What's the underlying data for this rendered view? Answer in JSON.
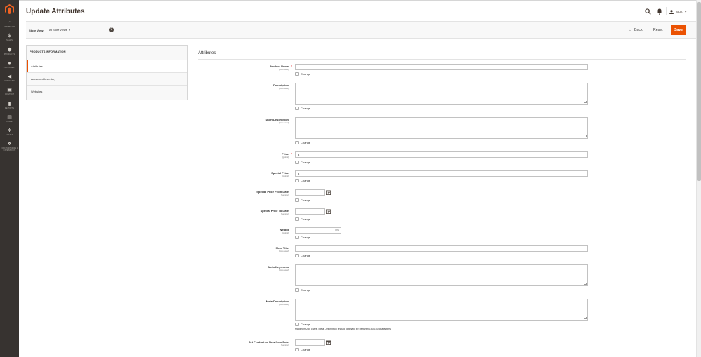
{
  "page": {
    "title": "Update Attributes"
  },
  "header": {
    "user_name": "Sturt"
  },
  "sidebar": {
    "items": [
      {
        "label": "Dashboard",
        "icon": "dashboard-icon"
      },
      {
        "label": "Sales",
        "icon": "dollar-icon"
      },
      {
        "label": "Products",
        "icon": "cube-icon"
      },
      {
        "label": "Customers",
        "icon": "user-icon"
      },
      {
        "label": "Marketing",
        "icon": "megaphone-icon"
      },
      {
        "label": "Content",
        "icon": "layout-icon"
      },
      {
        "label": "Reports",
        "icon": "bar-chart-icon"
      },
      {
        "label": "Stores",
        "icon": "store-icon"
      },
      {
        "label": "System",
        "icon": "gear-icon"
      },
      {
        "label": "Find Partners & Extensions",
        "icon": "extensions-icon"
      }
    ]
  },
  "toolbar": {
    "store_view_label": "Store View:",
    "store_view_value": "All Store Views",
    "help": "?",
    "back_label": "Back",
    "reset_label": "Reset",
    "save_label": "Save"
  },
  "tabs": {
    "title": "Products Information",
    "items": [
      "Attributes",
      "Advanced Inventory",
      "Websites"
    ],
    "active": "Attributes"
  },
  "fieldset": {
    "title": "Attributes",
    "change_label": "Change",
    "fields": [
      {
        "label": "Product Name",
        "scope": "[store view]",
        "required": true,
        "type": "text",
        "value": ""
      },
      {
        "label": "Description",
        "scope": "[store view]",
        "required": false,
        "type": "textarea",
        "value": ""
      },
      {
        "label": "Short Description",
        "scope": "[store view]",
        "required": false,
        "type": "textarea",
        "value": ""
      },
      {
        "label": "Price",
        "scope": "[global]",
        "required": true,
        "type": "price",
        "currency": "£",
        "value": ""
      },
      {
        "label": "Special Price",
        "scope": "[global]",
        "required": false,
        "type": "price",
        "currency": "£",
        "value": ""
      },
      {
        "label": "Special Price From Date",
        "scope": "[website]",
        "required": false,
        "type": "date",
        "value": ""
      },
      {
        "label": "Special Price To Date",
        "scope": "[website]",
        "required": false,
        "type": "date",
        "value": ""
      },
      {
        "label": "Weight",
        "scope": "[global]",
        "required": false,
        "type": "weight",
        "unit": "lbs",
        "value": ""
      },
      {
        "label": "Meta Title",
        "scope": "[store view]",
        "required": false,
        "type": "text",
        "value": ""
      },
      {
        "label": "Meta Keywords",
        "scope": "[store view]",
        "required": false,
        "type": "textarea",
        "value": ""
      },
      {
        "label": "Meta Description",
        "scope": "[store view]",
        "required": false,
        "type": "textarea",
        "value": "",
        "note": "Maximum 255 chars. Meta Description should optimally be between 150-160 characters"
      },
      {
        "label": "Set Product as New from Date",
        "scope": "[website]",
        "required": false,
        "type": "date",
        "value": ""
      }
    ]
  },
  "colors": {
    "sidebar_bg": "#373330",
    "accent": "#eb5202",
    "required": "#e22626"
  }
}
